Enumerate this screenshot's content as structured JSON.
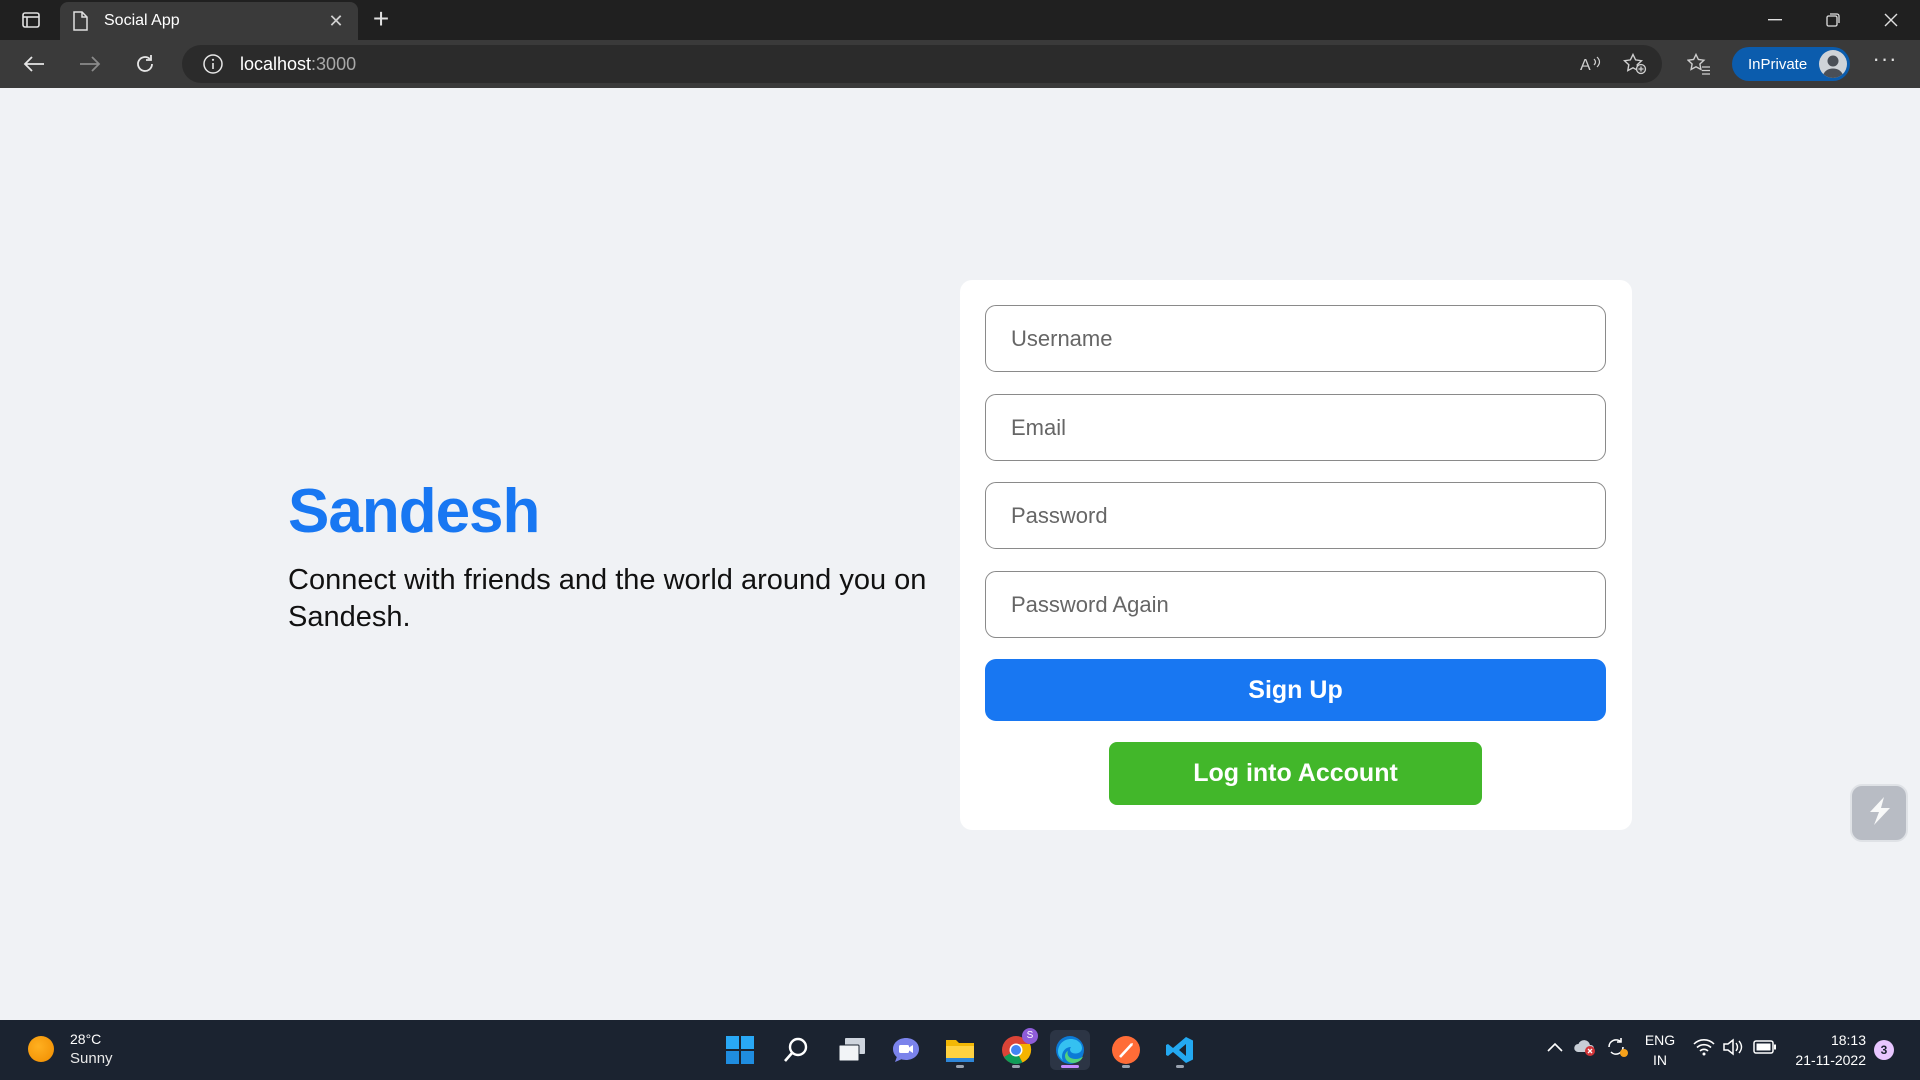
{
  "browser": {
    "tab_title": "Social App",
    "url_host": "localhost",
    "url_port": ":3000",
    "inprivate_label": "InPrivate",
    "more_label": "···",
    "new_tab_label": "+",
    "close_tab_label": "✕"
  },
  "page": {
    "brand": "Sandesh",
    "tagline": "Connect with friends and the world around you on Sandesh.",
    "form": {
      "username_placeholder": "Username",
      "email_placeholder": "Email",
      "password_placeholder": "Password",
      "password_again_placeholder": "Password Again",
      "signup_label": "Sign Up",
      "login_label": "Log into Account"
    }
  },
  "colors": {
    "brand_blue": "#1877f2",
    "login_green": "#42b72a",
    "page_bg": "#f0f2f5"
  },
  "taskbar": {
    "weather_temp": "28°C",
    "weather_condition": "Sunny",
    "apps": [
      "start-icon",
      "search-icon",
      "task-view-icon",
      "teams-chat-icon",
      "file-explorer-icon",
      "chrome-icon",
      "edge-icon",
      "postman-icon",
      "vscode-icon"
    ],
    "chrome_badge": "S",
    "language_top": "ENG",
    "language_bottom": "IN",
    "time": "18:13",
    "date": "21-11-2022",
    "notification_count": "3"
  }
}
